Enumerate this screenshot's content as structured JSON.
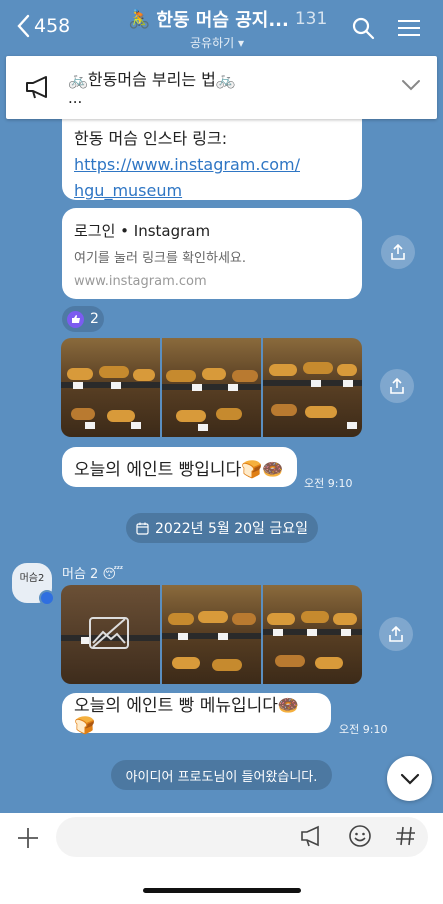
{
  "header": {
    "back_count": "458",
    "title": "한동 머슴 공지...",
    "member_count": "131",
    "subtitle": "공유하기"
  },
  "notice": {
    "line1": "🚲한동머슴 부리는 법🚲",
    "line2": "..."
  },
  "messages": {
    "insta_label": "한동 머슴 인스타 링크:",
    "insta_link_1": "https://www.instagram.com/",
    "insta_link_2": "hgu_museum",
    "card_title": "로그인 • Instagram",
    "card_desc": "여기를 눌러 링크를 확인하세요.",
    "card_url": "www.instagram.com",
    "reaction_count": "2",
    "msg1": "오늘의 에인트 빵입니다🍞🍩",
    "time1": "오전 9:10",
    "date": "2022년 5월 20일 금요일",
    "sender": "머슴 2 😴",
    "avatar_label": "머슴2",
    "msg2": "오늘의 에인트 빵 메뉴입니다🍩🍞",
    "time2": "오전 9:10",
    "system": "아이디어 프로도님이 들어왔습니다."
  },
  "colors": {
    "chat_bg": "#5b8fc0",
    "link": "#2f76c4"
  }
}
